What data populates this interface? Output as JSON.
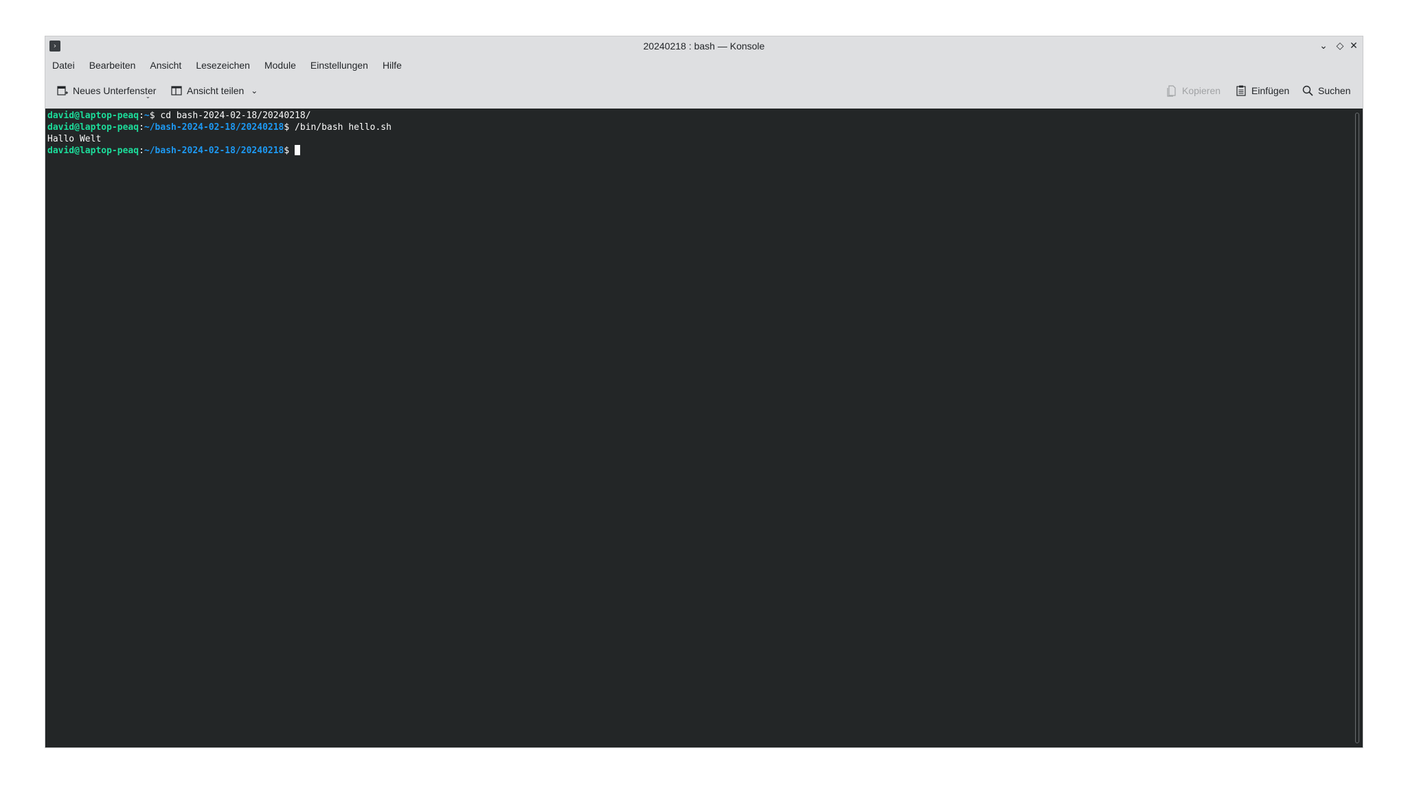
{
  "window": {
    "title": "20240218 : bash — Konsole",
    "app_icon": "terminal-prompt-icon",
    "controls": [
      "minimize-icon",
      "maximize-icon",
      "close-icon"
    ]
  },
  "menubar": {
    "items": [
      "Datei",
      "Bearbeiten",
      "Ansicht",
      "Lesezeichen",
      "Module",
      "Einstellungen",
      "Hilfe"
    ]
  },
  "toolbar": {
    "new_tab_label": "Neues Unterfenster",
    "split_view_label": "Ansicht teilen",
    "copy_label": "Kopieren",
    "paste_label": "Einfügen",
    "search_label": "Suchen"
  },
  "terminal": {
    "lines": [
      {
        "user": "david@laptop-peaq",
        "sep": ":",
        "path": "~",
        "prompt": "$ ",
        "cmd": "cd bash-2024-02-18/20240218/"
      },
      {
        "user": "david@laptop-peaq",
        "sep": ":",
        "path": "~/bash-2024-02-18/20240218",
        "prompt": "$ ",
        "cmd": "/bin/bash hello.sh"
      },
      {
        "output": "Hallo Welt"
      },
      {
        "user": "david@laptop-peaq",
        "sep": ":",
        "path": "~/bash-2024-02-18/20240218",
        "prompt": "$ ",
        "cmd": ""
      }
    ]
  },
  "colors": {
    "terminal_bg": "#232627",
    "user_host": "#1cdc9a",
    "path": "#1d99f3",
    "text": "#fcfcfc",
    "chrome": "#dedfe1"
  }
}
